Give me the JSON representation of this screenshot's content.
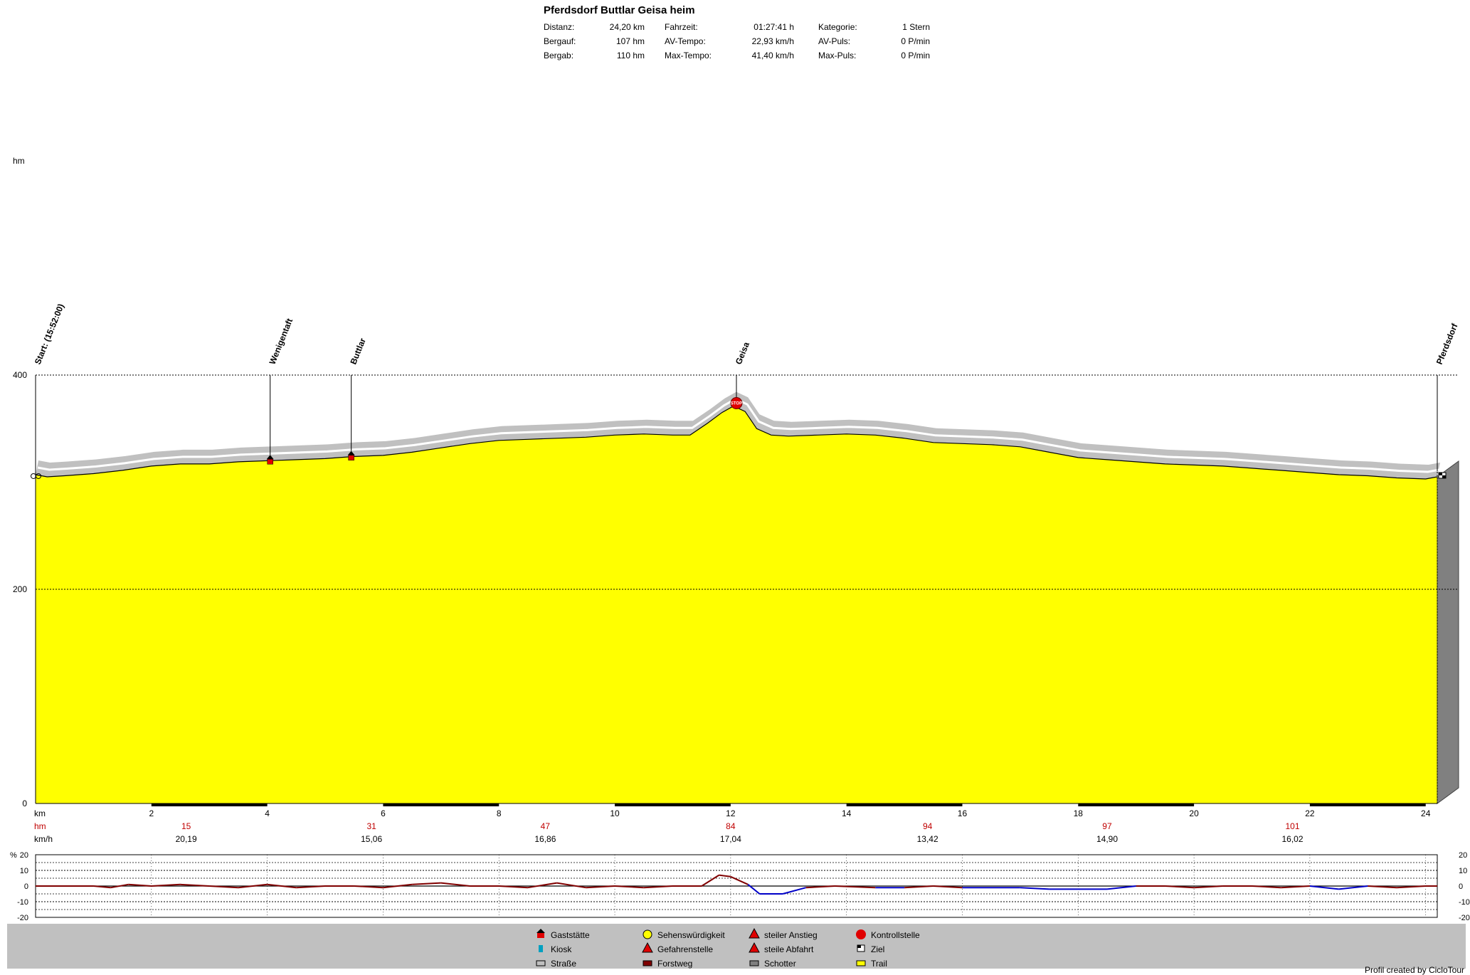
{
  "header": {
    "title": "Pferdsdorf Buttlar Geisa heim",
    "stats": [
      [
        {
          "label": "Distanz:",
          "value": "24,20 km"
        },
        {
          "label": "Fahrzeit:",
          "value": "01:27:41 h"
        },
        {
          "label": "Kategorie:",
          "value": "1 Stern"
        }
      ],
      [
        {
          "label": "Bergauf:",
          "value": "107 hm"
        },
        {
          "label": "AV-Tempo:",
          "value": "22,93 km/h"
        },
        {
          "label": "AV-Puls:",
          "value": "0 P/min"
        }
      ],
      [
        {
          "label": "Bergab:",
          "value": "110 hm"
        },
        {
          "label": "Max-Tempo:",
          "value": "41,40 km/h"
        },
        {
          "label": "Max-Puls:",
          "value": "0 P/min"
        }
      ]
    ]
  },
  "chart_data": {
    "type": "area",
    "ylabel": "hm",
    "xlabel": "km",
    "xlim": [
      0,
      24.2
    ],
    "ylim": [
      0,
      400
    ],
    "y_ticks": [
      0,
      200,
      400
    ],
    "x_ticks": [
      2,
      4,
      6,
      8,
      10,
      12,
      14,
      16,
      18,
      20,
      22,
      24
    ],
    "fill_color": "#ffff00",
    "road_color": "#c0c0c0",
    "profile": {
      "x": [
        0,
        0.2,
        0.5,
        1.0,
        1.5,
        2.0,
        2.5,
        3.0,
        3.5,
        4.0,
        4.5,
        5.0,
        5.5,
        6.0,
        6.5,
        7.0,
        7.5,
        8.0,
        8.5,
        9.0,
        9.5,
        10.0,
        10.5,
        11.0,
        11.3,
        11.6,
        11.85,
        12.05,
        12.25,
        12.45,
        12.7,
        13.0,
        13.5,
        14.0,
        14.5,
        15.0,
        15.5,
        16.0,
        16.5,
        17.0,
        17.5,
        18.0,
        18.5,
        19.0,
        19.5,
        20.0,
        20.5,
        21.0,
        21.5,
        22.0,
        22.5,
        23.0,
        23.5,
        24.0,
        24.2
      ],
      "y": [
        307,
        305,
        306,
        308,
        311,
        315,
        317,
        317,
        319,
        320,
        321,
        322,
        324,
        325,
        328,
        332,
        336,
        339,
        340,
        341,
        342,
        344,
        345,
        344,
        344,
        355,
        365,
        371,
        366,
        350,
        344,
        343,
        344,
        345,
        344,
        341,
        337,
        336,
        335,
        333,
        328,
        323,
        321,
        319,
        317,
        316,
        315,
        313,
        311,
        309,
        307,
        306,
        304,
        303,
        305
      ]
    },
    "waypoints": [
      {
        "km": 0.0,
        "label": "Start: (15:52:00)",
        "icon": "start"
      },
      {
        "km": 4.05,
        "label": "Wenigentaft",
        "icon": "gaststaette"
      },
      {
        "km": 5.45,
        "label": "Buttlar",
        "icon": "gaststaette"
      },
      {
        "km": 12.1,
        "label": "Geisa",
        "icon": "kontrollstelle"
      },
      {
        "km": 24.2,
        "label": "Pferdsdorf",
        "icon": "ziel"
      }
    ],
    "hm_row": {
      "label": "hm",
      "values": [
        {
          "km": 2.6,
          "v": "15"
        },
        {
          "km": 5.8,
          "v": "31"
        },
        {
          "km": 8.8,
          "v": "47"
        },
        {
          "km": 12.0,
          "v": "84"
        },
        {
          "km": 15.4,
          "v": "94"
        },
        {
          "km": 18.5,
          "v": "97"
        },
        {
          "km": 21.7,
          "v": "101"
        }
      ]
    },
    "kmh_row": {
      "label": "km/h",
      "values": [
        {
          "km": 2.6,
          "v": "20,19"
        },
        {
          "km": 5.8,
          "v": "15,06"
        },
        {
          "km": 8.8,
          "v": "16,86"
        },
        {
          "km": 12.0,
          "v": "17,04"
        },
        {
          "km": 15.4,
          "v": "13,42"
        },
        {
          "km": 18.5,
          "v": "14,90"
        },
        {
          "km": 21.7,
          "v": "16,02"
        }
      ]
    },
    "gradient": {
      "ylabel": "%",
      "ylim": [
        -20,
        20
      ],
      "y_ticks": [
        20,
        10,
        0,
        -10,
        -20
      ],
      "x": [
        0,
        1.0,
        1.3,
        1.6,
        2.0,
        2.5,
        3.0,
        3.5,
        4.0,
        4.5,
        5.0,
        5.5,
        6.0,
        6.5,
        7.0,
        7.5,
        8.0,
        8.5,
        9.0,
        9.5,
        10.0,
        10.5,
        11.0,
        11.5,
        11.8,
        12.0,
        12.3,
        12.5,
        12.9,
        13.3,
        13.8,
        14.5,
        15.0,
        15.5,
        16.0,
        17.0,
        17.5,
        18.5,
        19.0,
        19.5,
        20.0,
        20.5,
        21.0,
        21.5,
        22.0,
        22.5,
        23.0,
        23.5,
        24.0,
        24.2
      ],
      "values": [
        0,
        0,
        -1,
        1,
        0,
        1,
        0,
        -1,
        1,
        -1,
        0,
        0,
        -1,
        1,
        2,
        0,
        0,
        -1,
        2,
        -1,
        0,
        -1,
        0,
        0,
        7,
        6,
        1,
        -5,
        -5,
        -1,
        0,
        -1,
        -1,
        0,
        -1,
        -1,
        -2,
        -2,
        0,
        0,
        -1,
        0,
        0,
        -1,
        0,
        -2,
        0,
        -1,
        0,
        0
      ]
    }
  },
  "legend": {
    "items": [
      {
        "label": "Gaststätte",
        "icon": "gaststaette-icon"
      },
      {
        "label": "Sehenswürdigkeit",
        "icon": "sehenswuerdigkeit-icon"
      },
      {
        "label": "steiler Anstieg",
        "icon": "steiler-anstieg-icon"
      },
      {
        "label": "Kontrollstelle",
        "icon": "kontrollstelle-icon"
      },
      {
        "label": "Kiosk",
        "icon": "kiosk-icon"
      },
      {
        "label": "Gefahrenstelle",
        "icon": "gefahrenstelle-icon"
      },
      {
        "label": "steile Abfahrt",
        "icon": "steile-abfahrt-icon"
      },
      {
        "label": "Ziel",
        "icon": "ziel-icon"
      },
      {
        "label": "Straße",
        "icon": "strasse-icon"
      },
      {
        "label": "Forstweg",
        "icon": "forstweg-icon"
      },
      {
        "label": "Schotter",
        "icon": "schotter-icon"
      },
      {
        "label": "Trail",
        "icon": "trail-icon"
      }
    ]
  },
  "footer": {
    "credit": "Profil created by CicloTour"
  }
}
